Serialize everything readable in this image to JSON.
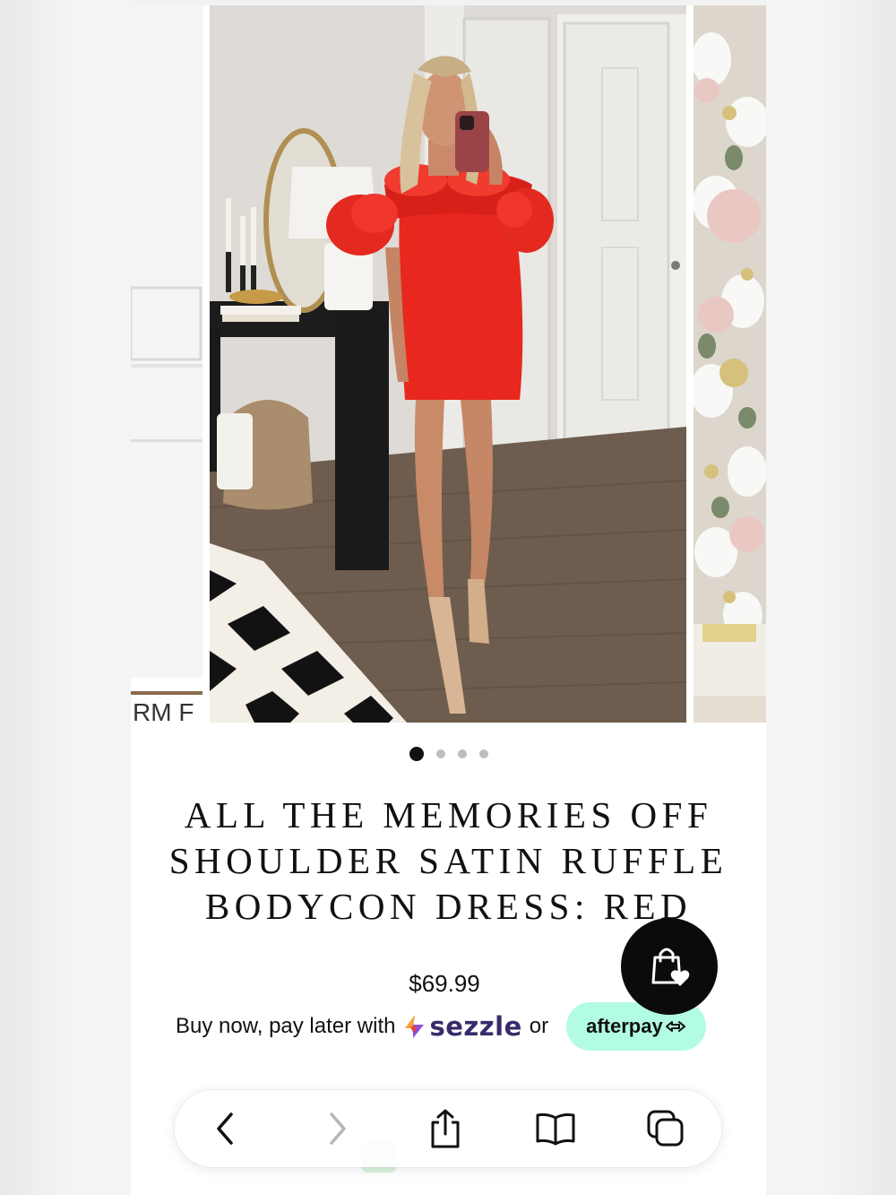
{
  "product": {
    "title": "ALL THE MEMORIES OFF SHOULDER SATIN RUFFLE BODYCON DRESS: RED",
    "price": "$69.99",
    "image_alt": "Model in red off shoulder satin ruffle bodycon dress",
    "primary_color": "#e8281e"
  },
  "gallery": {
    "current_index": 1,
    "total": 4,
    "zoom_icon": "search-icon",
    "side_sign_text": "RM F"
  },
  "bnpl": {
    "prefix": "Buy now, pay later with",
    "sezzle": "sezzle",
    "or": "or",
    "afterpay": "afterpay",
    "afterpay_color": "#b2fce4"
  },
  "floating": {
    "wishlist_bag_icon": "shopping-bag-heart-icon"
  },
  "browser_toolbar": {
    "back_icon": "chevron-left-icon",
    "forward_icon": "chevron-right-icon",
    "share_icon": "share-icon",
    "bookmarks_icon": "book-icon",
    "tabs_icon": "tabs-icon"
  }
}
